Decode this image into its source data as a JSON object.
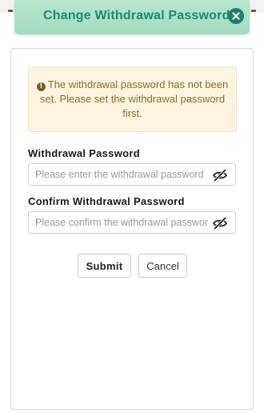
{
  "dialog": {
    "title": "Change Withdrawal Password",
    "close_icon": "close-circle-icon"
  },
  "alert": {
    "icon": "info-circle-icon",
    "icon_glyph": "!",
    "message": "The withdrawal password has not been set. Please set the withdrawal password first."
  },
  "form": {
    "password": {
      "label": "Withdrawal Password",
      "placeholder": "Please enter the withdrawal password",
      "value": "",
      "toggle_icon": "eye-slash-icon"
    },
    "confirm": {
      "label": "Confirm Withdrawal Password",
      "placeholder": "Please confirm the withdrawal password",
      "value": "",
      "toggle_icon": "eye-slash-icon"
    }
  },
  "actions": {
    "submit_label": "Submit",
    "cancel_label": "Cancel"
  },
  "colors": {
    "header_bg": "#a8dec4",
    "header_text": "#1d8a76",
    "close_bg": "#1e7f6e",
    "alert_bg": "#fdf5e1",
    "alert_text": "#8d6e2a"
  }
}
